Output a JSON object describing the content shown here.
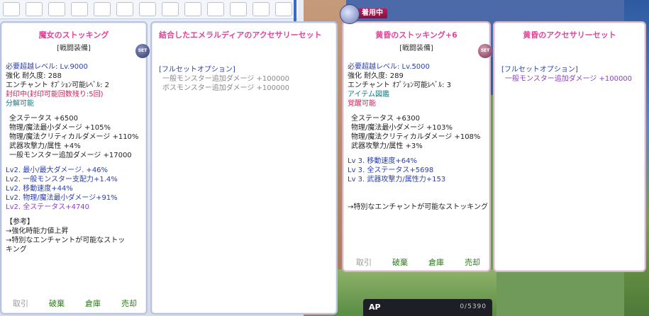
{
  "equipped_label": "着用中",
  "set_badge": "SET",
  "panel1": {
    "title": "魔女のストッキング",
    "sub": "[戦闘装備]",
    "lines": [
      {
        "text": "必要超越レベル: Lv.9000",
        "cls": "blue"
      },
      {
        "text": "強化  耐久度: 288",
        "cls": ""
      },
      {
        "text": "エンチャント  ｵﾌﾟｼｮﾝ可能ﾚﾍﾞﾙ: 2",
        "cls": ""
      },
      {
        "text": "封印中(封印可能回数残り:5回)",
        "cls": "red"
      },
      {
        "text": "分解可能",
        "cls": "teal"
      }
    ],
    "stats": [
      "全ステータス +6500",
      "物理/魔法最小ダメージ +105%",
      "物理/魔法クリティカルダメージ +110%",
      "武器攻撃力/属性 +4%",
      "一般モンスター追加ダメージ +17000"
    ],
    "options": [
      {
        "text": "Lv2. 最小/最大ダメージ. +46%",
        "cls": "blue"
      },
      {
        "text": "Lv2. 一般モンスター支配力+1.4%",
        "cls": "blue"
      },
      {
        "text": "Lv2. 移動速度+44%",
        "cls": "blue"
      },
      {
        "text": "Lv2. 物理/魔法最小ダメージ+91%",
        "cls": "blue"
      },
      {
        "text": "Lv2. 全ステータス+4740",
        "cls": "purple"
      }
    ],
    "notes": [
      "【参考】",
      "→強化時能力値上昇",
      "→特別なエンチャントが可能なストッ",
      "キング"
    ],
    "actions": [
      "取引",
      "破棄",
      "倉庫",
      "売却"
    ]
  },
  "panel2": {
    "title": "結合したエメラルディアのアクセサリーセット",
    "full_set_label": "[フルセットオプション]",
    "set_lines": [
      "一般モンスター追加ダメージ +100000",
      "ボスモンスター追加ダメージ +100000"
    ]
  },
  "panel3": {
    "title": "黄昏のストッキング+6",
    "sub": "[戦闘装備]",
    "lines": [
      {
        "text": "必要超越レベル: Lv.5000",
        "cls": "blue"
      },
      {
        "text": "強化  耐久度: 289",
        "cls": ""
      },
      {
        "text": "エンチャント  ｵﾌﾟｼｮﾝ可能ﾚﾍﾞﾙ: 3",
        "cls": ""
      },
      {
        "text": "アイテム図鑑",
        "cls": "teal"
      },
      {
        "text": "覚醒可能",
        "cls": "red"
      }
    ],
    "stats": [
      "全ステータス +6300",
      "物理/魔法最小ダメージ +103%",
      "物理/魔法クリティカルダメージ +108%",
      "武器攻撃力/属性 +3%"
    ],
    "options": [
      {
        "text": "Lv 3. 移動速度+64%",
        "cls": "blue"
      },
      {
        "text": "Lv 3. 全ステータス+5698",
        "cls": "blue"
      },
      {
        "text": "Lv 3. 武器攻撃力/属性力+153",
        "cls": "blue"
      }
    ],
    "notes": [
      "→特別なエンチャントが可能なストッキング"
    ],
    "actions": [
      "取引",
      "破棄",
      "倉庫",
      "売却"
    ]
  },
  "panel4": {
    "title": "黄昏のアクセサリーセット",
    "full_set_label": "[フルセットオプション]",
    "set_lines": [
      "一般モンスター追加ダメージ +100000"
    ]
  },
  "ap": {
    "label": "AP",
    "value": "0/5390"
  }
}
